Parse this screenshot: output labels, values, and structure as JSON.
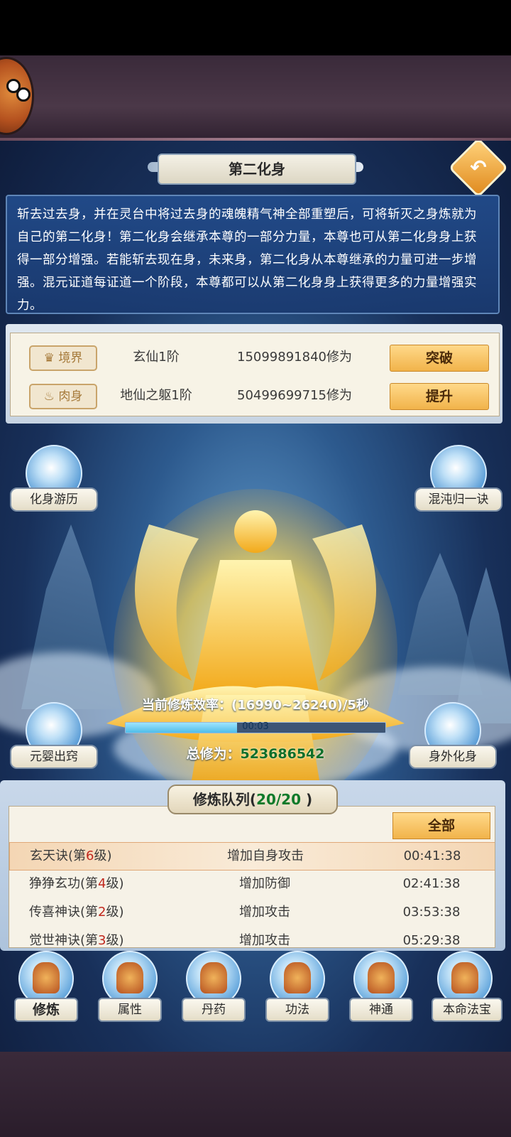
{
  "header": {
    "title": "第二化身"
  },
  "description": "斩去过去身，并在灵台中将过去身的魂魄精气神全部重塑后，可将斩灭之身炼就为自己的第二化身！第二化身会继承本尊的一部分力量，本尊也可从第二化身身上获得一部分增强。若能斩去现在身，未来身，第二化身从本尊继承的力量可进一步增强。混元证道每证道一个阶段，本尊都可以从第二化身身上获得更多的力量增强实力。",
  "stats": [
    {
      "tag": "境界",
      "name": "玄仙1阶",
      "value": "15099891840修为",
      "button": "突破"
    },
    {
      "tag": "肉身",
      "name": "地仙之躯1阶",
      "value": "50499699715修为",
      "button": "提升"
    }
  ],
  "scene_buttons": {
    "journey": "化身游历",
    "chaos": "混沌归一诀",
    "infant": "元婴出窍",
    "avatar": "身外化身"
  },
  "cultivation": {
    "rate_text": "当前修炼效率：(16990~26240)/5秒",
    "timer": "00:03",
    "progress": 0.43,
    "total_label": "总修为：",
    "total_value": "523686542"
  },
  "queue": {
    "title_prefix": "修炼队列(",
    "count": "20/20",
    "title_suffix": " )",
    "all_button": "全部",
    "rows": [
      {
        "name_pre": "玄天诀(第",
        "level": "6",
        "name_post": "级)",
        "effect": "增加自身攻击",
        "time": "00:41:38"
      },
      {
        "name_pre": "狰狰玄功(第",
        "level": "4",
        "name_post": "级)",
        "effect": "增加防御",
        "time": "02:41:38"
      },
      {
        "name_pre": "传喜神诀(第",
        "level": "2",
        "name_post": "级)",
        "effect": "增加攻击",
        "time": "03:53:38"
      },
      {
        "name_pre": "觉世神诀(第",
        "level": "3",
        "name_post": "级)",
        "effect": "增加攻击",
        "time": "05:29:38"
      }
    ]
  },
  "tabs": [
    "修炼",
    "属性",
    "丹药",
    "功法",
    "神通",
    "本命法宝"
  ],
  "colors": {
    "accent_gold": "#f1b34a",
    "panel_blue": "#224c8c",
    "green_value": "#0f6f2a",
    "level_red": "#c0271d"
  }
}
